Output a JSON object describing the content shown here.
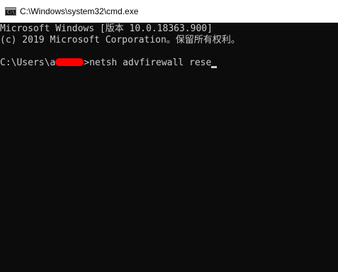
{
  "window": {
    "title": "C:\\Windows\\system32\\cmd.exe",
    "icon": "cmd-icon",
    "icon_glyph": "C:\\"
  },
  "console": {
    "line1": "Microsoft Windows [版本 10.0.18363.900]",
    "line2": "(c) 2019 Microsoft Corporation。保留所有权利。",
    "prompt_prefix": "C:\\Users\\a",
    "prompt_suffix": ">",
    "command": "netsh advfirewall rese"
  },
  "colors": {
    "background": "#0c0c0c",
    "text": "#cccccc",
    "redaction": "#ff0000",
    "titlebar": "#ffffff"
  }
}
